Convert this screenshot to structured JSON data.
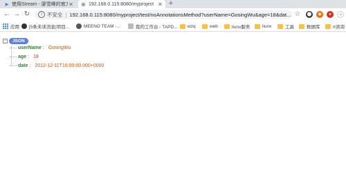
{
  "tabs": [
    {
      "title": "使用Stream - 廖雪峰的官方网站",
      "icon": "stream-favicon",
      "active": false
    },
    {
      "title": "192.168.0.115:8080/myproject",
      "icon": "globe-icon",
      "active": true
    }
  ],
  "toolbar": {
    "security_text": "不安全",
    "url": "192.168.0.115:8080/myproject/test/noAnnotationsMethod?userName=GosingWu&age=18&dat..."
  },
  "bookmarks": [
    {
      "label": "应用",
      "icon": "apps-grid-icon"
    },
    {
      "label": "[5条未读消息]项目...",
      "icon": "csdn-icon"
    },
    {
      "label": "MEENO TEAM -...",
      "icon": "meeno-icon"
    },
    {
      "label": "我的工作台 - TAPD...",
      "icon": "tapd-icon"
    },
    {
      "label": "wzq",
      "icon": "folder-icon"
    },
    {
      "label": "web",
      "icon": "folder-icon"
    },
    {
      "label": "liunx服务",
      "icon": "folder-icon"
    },
    {
      "label": "liunx",
      "icon": "folder-icon"
    },
    {
      "label": "工具",
      "icon": "folder-icon"
    },
    {
      "label": "数据库",
      "icon": "folder-icon"
    },
    {
      "label": "rt咨询",
      "icon": "folder-icon"
    }
  ],
  "json_view": {
    "root_label": "JSON",
    "collapse_symbol": "−",
    "entries": [
      {
        "key": "userName",
        "value": "GosingWu",
        "type": "string"
      },
      {
        "key": "age",
        "value": "18",
        "type": "number"
      },
      {
        "key": "date",
        "value": "2012-12-11T16:00:00.000+0000",
        "type": "string"
      }
    ]
  },
  "colors": {
    "key": "#2e7d32",
    "string_value": "#d35400",
    "number_value": "#b03a2e",
    "badge": "#5b7fe6"
  }
}
